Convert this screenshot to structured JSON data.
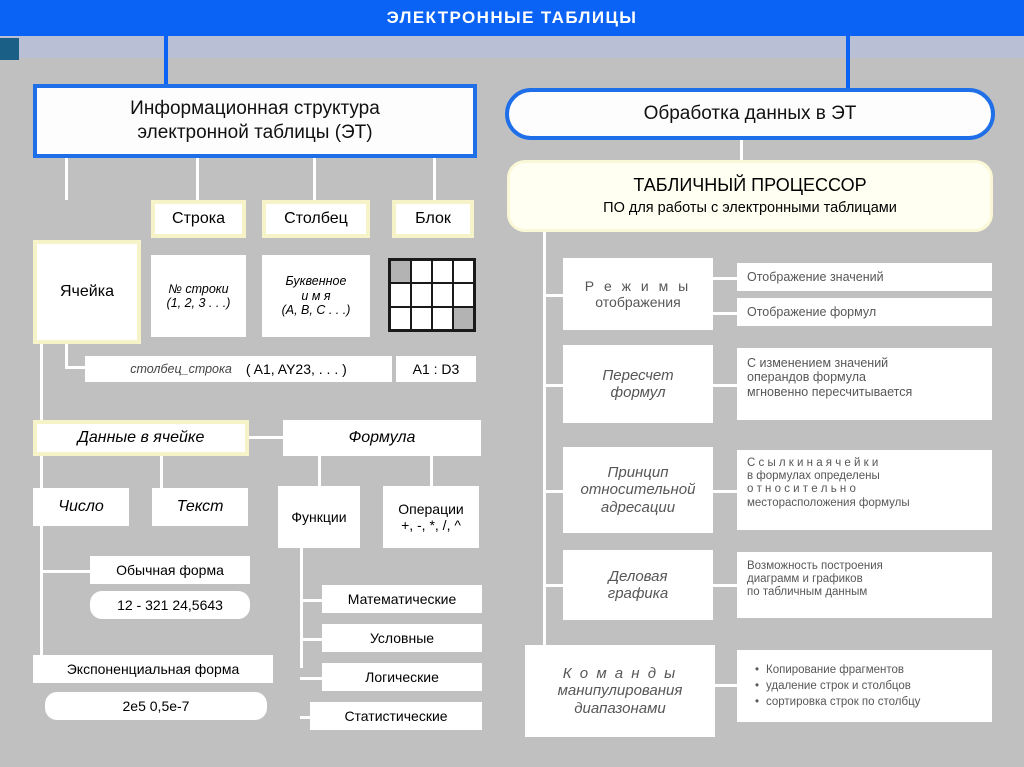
{
  "header": {
    "title": "ЭЛЕКТРОННЫЕ ТАБЛИЦЫ",
    "banner_color": "#0a63f5",
    "subbar_color": "#b9c0d6",
    "corner_color": "#1a5f86",
    "background_color": "#c0c0c0"
  },
  "left_branch": {
    "root": "Информационная структура электронной таблицы (ЭТ)",
    "root_line1": "Информационная структура",
    "root_line2": "электронной таблицы (ЭТ)",
    "nodes": {
      "cell": "Ячейка",
      "row": "Строка",
      "column": "Столбец",
      "block": "Блок",
      "row_number_line1": "№ строки",
      "row_number_line2": "(1, 2, 3 . . .)",
      "column_name_line1": "Буквенное",
      "column_name_line2": "и м я",
      "column_name_line3": "(A, B, C . . .)",
      "address_label": "столбец_строка",
      "address_examples": "( A1, AY23, . . . )",
      "block_range": "A1 : D3",
      "cell_data": "Данные в ячейке",
      "formula": "Формула",
      "number": "Число",
      "text": "Текст",
      "normal_form": "Обычная форма",
      "normal_form_examples": "12  - 321  24,5643",
      "exponential_form": "Экспоненциальная форма",
      "exponential_form_examples": "2e5   0,5e-7",
      "functions": "Функции",
      "operations_line1": "Операции",
      "operations_line2": "+, -, *, /, ^",
      "function_kinds": [
        "Математические",
        "Условные",
        "Логические",
        "Статистические"
      ]
    },
    "block_grid": {
      "cols": 4,
      "rows": 3,
      "shaded_cells": [
        0,
        11
      ]
    }
  },
  "right_branch": {
    "root": "Обработка   данных в ЭТ",
    "processor_title": "ТАБЛИЧНЫЙ ПРОЦЕССОР",
    "processor_subtitle": "ПО для работы с электронными таблицами",
    "features": [
      {
        "title_line1": "Р е ж и м ы",
        "title_line2": "отображения",
        "details": [
          [
            "Отображение значений"
          ],
          [
            "Отображение формул"
          ]
        ]
      },
      {
        "title_line1": "Пересчет",
        "title_line2": "формул",
        "details": [
          [
            "С изменением значений",
            "операндов формула",
            "мгновенно пересчитывается"
          ]
        ]
      },
      {
        "title_line1": "Принцип",
        "title_line2": "относительной",
        "title_line3": "адресации",
        "details": [
          [
            "С с ы л к и   н а   я ч е й к и",
            "в формулах определены",
            "о т н о с и т е л ь н о",
            "месторасположения формулы"
          ]
        ]
      },
      {
        "title_line1": "Деловая",
        "title_line2": "графика",
        "details": [
          [
            "Возможность построения",
            "диаграмм и графиков",
            "по табличным данным"
          ]
        ]
      },
      {
        "title_line1": "К о м а н д ы",
        "title_line2": "манипулирования",
        "title_line3": "диапазонами",
        "bullets": [
          "Копирование фрагментов",
          "удаление строк и столбцов",
          "сортировка строк по столбцу"
        ]
      }
    ]
  }
}
